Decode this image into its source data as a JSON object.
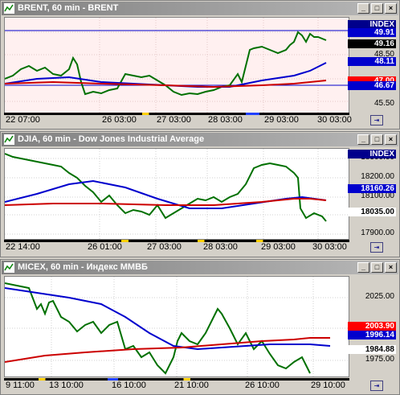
{
  "panels": [
    {
      "title": "BRENT, 60 min - BRENT",
      "y_labels": [
        "49.91",
        "49.16",
        "48.50",
        "47.00",
        "46.67",
        "45.50"
      ],
      "tags": [
        {
          "text": "INDEX",
          "color": "#00008b"
        },
        {
          "text": "49.91",
          "color": "#0000cd"
        },
        {
          "text": "49.16",
          "color": "#000000"
        },
        {
          "text": "48.11",
          "color": "#0000cd"
        },
        {
          "text": "47.00",
          "color": "#ff0000"
        },
        {
          "text": "46.67",
          "color": "#0000cd"
        }
      ],
      "x_labels": [
        "22 07:00",
        "26 03:00",
        "27 03:00",
        "28 03:00",
        "29 03:00",
        "30 03:00"
      ],
      "bg": "#fff0f0"
    },
    {
      "title": "DJIA, 60 min - Dow Jones Industrial Average",
      "y_labels": [
        "18300.00",
        "18200.00",
        "18100.00",
        "18000.00",
        "17900.00"
      ],
      "tags": [
        {
          "text": "INDEX",
          "color": "#00008b"
        },
        {
          "text": "18160.26",
          "color": "#0000cd"
        },
        {
          "text": "18035.00",
          "color": "#000000"
        }
      ],
      "x_labels": [
        "22 14:00",
        "26 01:00",
        "27 03:00",
        "28 03:00",
        "29 03:00",
        "30 03:00"
      ],
      "bg": "#ffffff"
    },
    {
      "title": "MICEX, 60 min - Индекс ММВБ",
      "y_labels": [
        "2025.00",
        "2000.00",
        "1975.00"
      ],
      "tags": [
        {
          "text": "2003.90",
          "color": "#ff0000"
        },
        {
          "text": "1996.14",
          "color": "#0000cd"
        },
        {
          "text": "1984.88",
          "color": "#000000"
        }
      ],
      "x_labels": [
        "9 11:00",
        "13 10:00",
        "16 10:00",
        "21 10:00",
        "26 10:00",
        "29 10:00"
      ],
      "bg": "#ffffff"
    }
  ],
  "colors": {
    "candle": "#007000",
    "ma_blue": "#0000cd",
    "ma_red": "#cc0000",
    "titlebar": "#808080"
  }
}
